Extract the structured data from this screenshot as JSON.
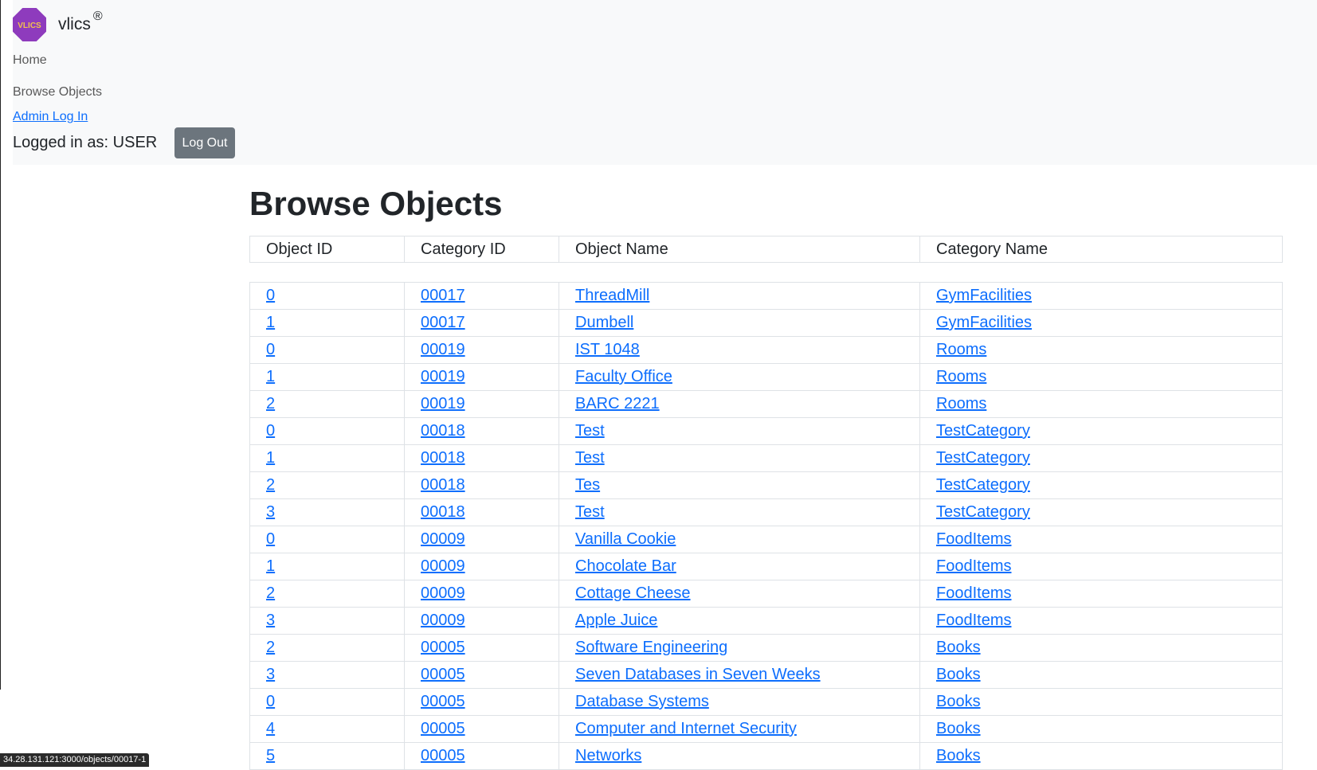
{
  "brand": {
    "logo_text": "VLICS",
    "name": "vlics",
    "mark": "®"
  },
  "nav": {
    "home": "Home",
    "browse": "Browse Objects",
    "admin_login": "Admin Log In"
  },
  "user": {
    "status": "Logged in as: USER",
    "logout": "Log Out"
  },
  "page_title": "Browse Objects",
  "table": {
    "headers": [
      "Object ID",
      "Category ID",
      "Object Name",
      "Category Name"
    ],
    "rows": [
      [
        "0",
        "00017",
        "ThreadMill",
        "GymFacilities"
      ],
      [
        "1",
        "00017",
        "Dumbell",
        "GymFacilities"
      ],
      [
        "0",
        "00019",
        "IST 1048",
        "Rooms"
      ],
      [
        "1",
        "00019",
        "Faculty Office",
        "Rooms"
      ],
      [
        "2",
        "00019",
        "BARC 2221",
        "Rooms"
      ],
      [
        "0",
        "00018",
        "Test",
        "TestCategory"
      ],
      [
        "1",
        "00018",
        "Test",
        "TestCategory"
      ],
      [
        "2",
        "00018",
        "Tes",
        "TestCategory"
      ],
      [
        "3",
        "00018",
        "Test",
        "TestCategory"
      ],
      [
        "0",
        "00009",
        "Vanilla Cookie",
        "FoodItems"
      ],
      [
        "1",
        "00009",
        "Chocolate Bar",
        "FoodItems"
      ],
      [
        "2",
        "00009",
        "Cottage Cheese",
        "FoodItems"
      ],
      [
        "3",
        "00009",
        "Apple Juice",
        "FoodItems"
      ],
      [
        "2",
        "00005",
        "Software Engineering",
        "Books"
      ],
      [
        "3",
        "00005",
        "Seven Databases in Seven Weeks",
        "Books"
      ],
      [
        "0",
        "00005",
        "Database Systems",
        "Books"
      ],
      [
        "4",
        "00005",
        "Computer and Internet Security",
        "Books"
      ],
      [
        "5",
        "00005",
        "Networks",
        "Books"
      ]
    ]
  },
  "status_bar": {
    "url": "34.28.131.121:3000/objects/00017-1"
  },
  "colors": {
    "link": "#0d6efd",
    "navbar_bg": "#f8f9fa",
    "logo_purple": "#8e3bbd",
    "logo_text": "#f2c14e"
  }
}
